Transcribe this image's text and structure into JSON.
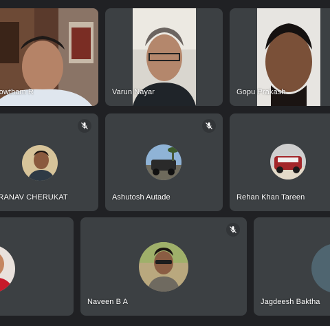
{
  "participants": [
    {
      "name": "Gowtham R"
    },
    {
      "name": "Varun Nayar"
    },
    {
      "name": "Gopu Prakash"
    },
    {
      "name": "PRANAV CHERUKAT"
    },
    {
      "name": "Ashutosh Autade"
    },
    {
      "name": "Rehan Khan Tareen"
    },
    {
      "name": ""
    },
    {
      "name": "Naveen B A"
    },
    {
      "name": "Jagdeesh Baktha"
    }
  ],
  "colors": {
    "background": "#202124",
    "tile": "#3c4043",
    "text": "#ffffff"
  },
  "icons": {
    "mic_off": "microphone-off-icon"
  }
}
